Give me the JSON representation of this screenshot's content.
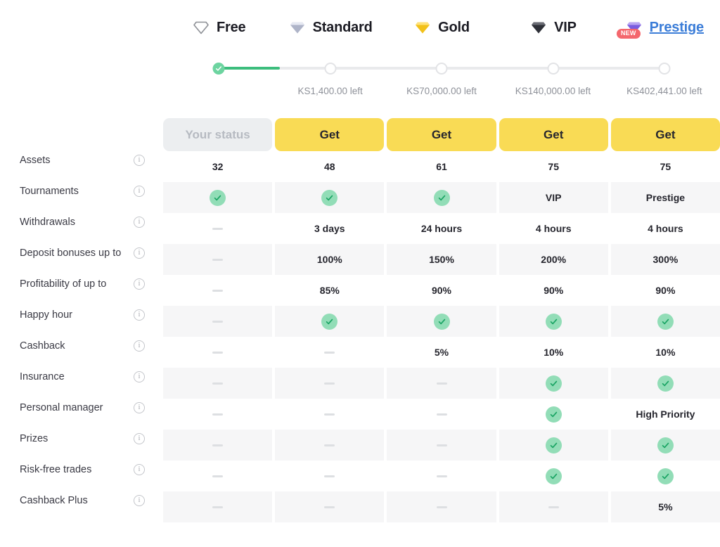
{
  "tabs": [
    {
      "label": "Free",
      "icon": "diamond-outline-icon",
      "active": false,
      "badge": null
    },
    {
      "label": "Standard",
      "icon": "diamond-silver-icon",
      "active": false,
      "badge": null
    },
    {
      "label": "Gold",
      "icon": "diamond-gold-icon",
      "active": false,
      "badge": null
    },
    {
      "label": "VIP",
      "icon": "diamond-black-icon",
      "active": false,
      "badge": null
    },
    {
      "label": "Prestige",
      "icon": "diamond-purple-icon",
      "active": true,
      "badge": "NEW"
    }
  ],
  "progress": {
    "fill_percent": 55,
    "nodes": [
      {
        "state": "done"
      },
      {
        "state": "pending"
      },
      {
        "state": "pending"
      },
      {
        "state": "pending"
      },
      {
        "state": "pending"
      }
    ],
    "labels": [
      "",
      "KS1,400.00 left",
      "KS70,000.00 left",
      "KS140,000.00 left",
      "KS402,441.00 left"
    ]
  },
  "actions": [
    {
      "label": "Your status",
      "kind": "status"
    },
    {
      "label": "Get",
      "kind": "get"
    },
    {
      "label": "Get",
      "kind": "get"
    },
    {
      "label": "Get",
      "kind": "get"
    },
    {
      "label": "Get",
      "kind": "get"
    }
  ],
  "features": [
    "Assets",
    "Tournaments",
    "Withdrawals",
    "Deposit bonuses up to",
    "Profitability of up to",
    "Happy hour",
    "Cashback",
    "Insurance",
    "Personal manager",
    "Prizes",
    "Risk-free trades",
    "Cashback Plus"
  ],
  "rows": [
    {
      "shaded": false,
      "cells": [
        "32",
        "48",
        "61",
        "75",
        "75"
      ]
    },
    {
      "shaded": true,
      "cells": [
        "check",
        "check",
        "check",
        "VIP",
        "Prestige"
      ]
    },
    {
      "shaded": false,
      "cells": [
        "dash",
        "3 days",
        "24 hours",
        "4 hours",
        "4 hours"
      ]
    },
    {
      "shaded": true,
      "cells": [
        "dash",
        "100%",
        "150%",
        "200%",
        "300%"
      ]
    },
    {
      "shaded": false,
      "cells": [
        "dash",
        "85%",
        "90%",
        "90%",
        "90%"
      ]
    },
    {
      "shaded": true,
      "cells": [
        "dash",
        "check",
        "check",
        "check",
        "check"
      ]
    },
    {
      "shaded": false,
      "cells": [
        "dash",
        "dash",
        "5%",
        "10%",
        "10%"
      ]
    },
    {
      "shaded": true,
      "cells": [
        "dash",
        "dash",
        "dash",
        "check",
        "check"
      ]
    },
    {
      "shaded": false,
      "cells": [
        "dash",
        "dash",
        "dash",
        "check",
        "High Priority"
      ]
    },
    {
      "shaded": true,
      "cells": [
        "dash",
        "dash",
        "dash",
        "check",
        "check"
      ]
    },
    {
      "shaded": false,
      "cells": [
        "dash",
        "dash",
        "dash",
        "check",
        "check"
      ]
    },
    {
      "shaded": true,
      "cells": [
        "dash",
        "dash",
        "dash",
        "dash",
        "5%"
      ]
    }
  ],
  "colors": {
    "accent_yellow": "#f9db55",
    "check_green": "#92ddb7",
    "progress_green": "#3cbd7d",
    "badge_red": "#f4676d",
    "link_blue": "#3b7dd8",
    "row_shade": "#f6f6f7"
  }
}
